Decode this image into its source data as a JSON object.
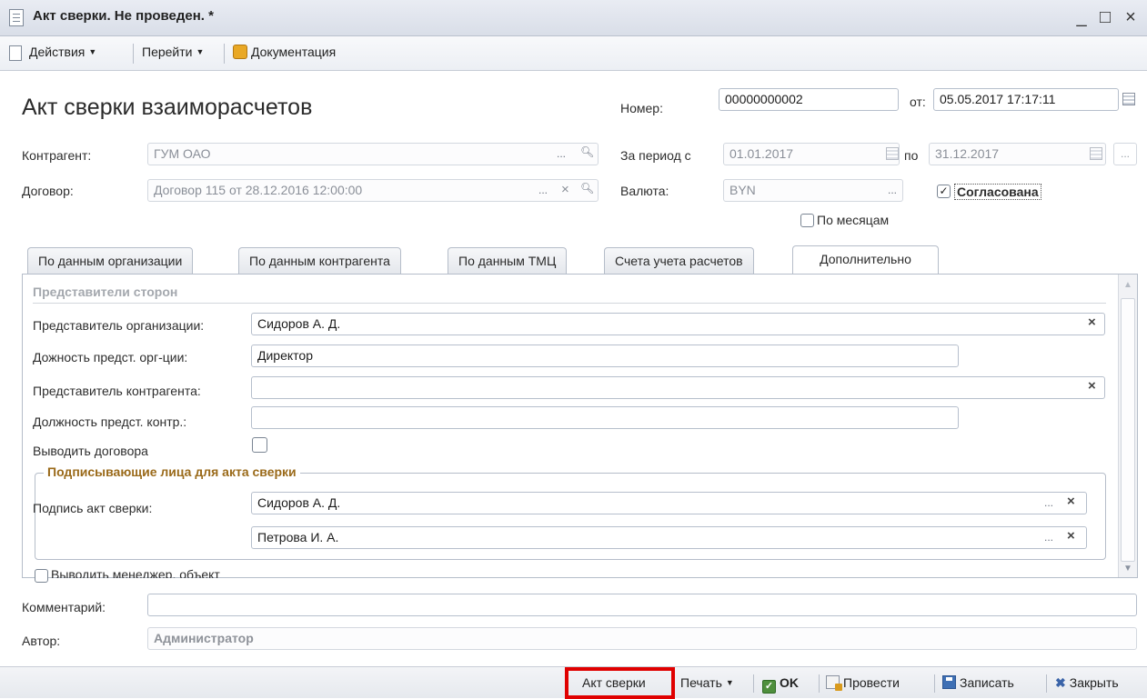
{
  "window": {
    "title": "Акт сверки. Не проведен. *",
    "minimize": "_",
    "maximize": "□",
    "close": "×"
  },
  "toolbar": {
    "actions": "Действия",
    "goto": "Перейти",
    "docs": "Документация"
  },
  "form": {
    "heading": "Акт сверки взаиморасчетов",
    "number_label": "Номер:",
    "number_value": "00000000002",
    "from_label": "от:",
    "date_value": "05.05.2017 17:17:11",
    "counterparty_label": "Контрагент:",
    "counterparty_value": "ГУМ ОАО",
    "period_label": "За период с",
    "period_from": "01.01.2017",
    "period_to_label": "по",
    "period_to": "31.12.2017",
    "contract_label": "Договор:",
    "contract_value": "Договор  115 от 28.12.2016 12:00:00",
    "currency_label": "Валюта:",
    "currency_value": "BYN",
    "agreed_label": "Согласована",
    "agreed_checked": true,
    "by_months_label": "По месяцам",
    "by_months_checked": false,
    "ellipsis": "...",
    "clear": "×"
  },
  "tabs": [
    {
      "label": "По данным организации"
    },
    {
      "label": "По данным контрагента"
    },
    {
      "label": "По данным ТМЦ"
    },
    {
      "label": "Счета учета расчетов"
    },
    {
      "label": "Дополнительно"
    }
  ],
  "tab_additional": {
    "section_title": "Представители сторон",
    "org_rep_label": "Представитель организации:",
    "org_rep_value": "Сидоров А. Д.",
    "org_pos_label": "Дожность предст. орг-ции:",
    "org_pos_value": "Директор",
    "cp_rep_label": "Представитель контрагента:",
    "cp_rep_value": "",
    "cp_pos_label": "Должность предст. контр.:",
    "cp_pos_value": "",
    "show_contracts_label": "Выводить договора",
    "show_contracts_checked": false,
    "group_title": "Подписывающие лица для акта сверки",
    "sign_label": "Подпись акт сверки:",
    "signer1": "Сидоров А. Д.",
    "signer2": "Петрова И. А.",
    "show_manager_label": "Выводить менеджер. объект"
  },
  "footer": {
    "comment_label": "Комментарий:",
    "comment_value": "",
    "author_label": "Автор:",
    "author_value": "Администратор"
  },
  "statusbar": {
    "act": "Акт сверки",
    "print": "Печать",
    "ok": "OK",
    "post": "Провести",
    "save": "Записать",
    "close": "Закрыть"
  }
}
